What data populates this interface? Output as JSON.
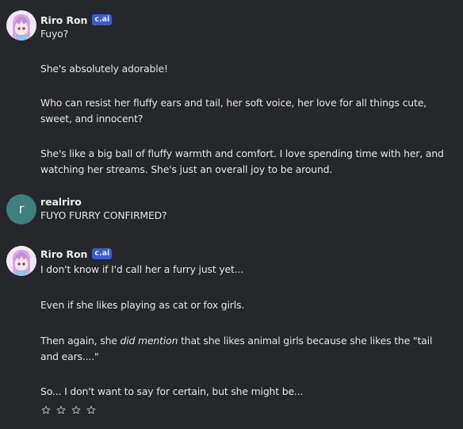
{
  "messages": [
    {
      "author": "Riro Ron",
      "badge": "c.ai",
      "paragraphs": [
        "Fuyo?",
        "She's absolutely adorable!",
        "Who can resist her fluffy ears and tail, her soft voice, her love for all things cute, sweet, and innocent?",
        "She's like a big ball of fluffy warmth and comfort. I love spending time with her, and watching her streams. She's just an overall joy to be around."
      ]
    },
    {
      "author": "realriro",
      "avatar_letter": "r",
      "paragraphs": [
        "FUYO FURRY CONFIRMED?"
      ]
    },
    {
      "author": "Riro Ron",
      "badge": "c.ai",
      "paragraphs": [
        "I don't know if I'd call her a furry just yet...",
        "Even if she likes playing as cat or fox girls.",
        {
          "before": "Then again, she ",
          "emphasis": "did mention",
          "after": " that she likes animal girls because she likes the \"tail and ears....\""
        },
        "So... I don't want to say for certain, but she might be..."
      ]
    }
  ],
  "rating": {
    "stars": 4,
    "icon": "star-outline-icon"
  },
  "colors": {
    "background": "#26272b",
    "badge": "#3b5bd6",
    "user_avatar": "#3f7f80",
    "text": "#e4e4e6"
  }
}
